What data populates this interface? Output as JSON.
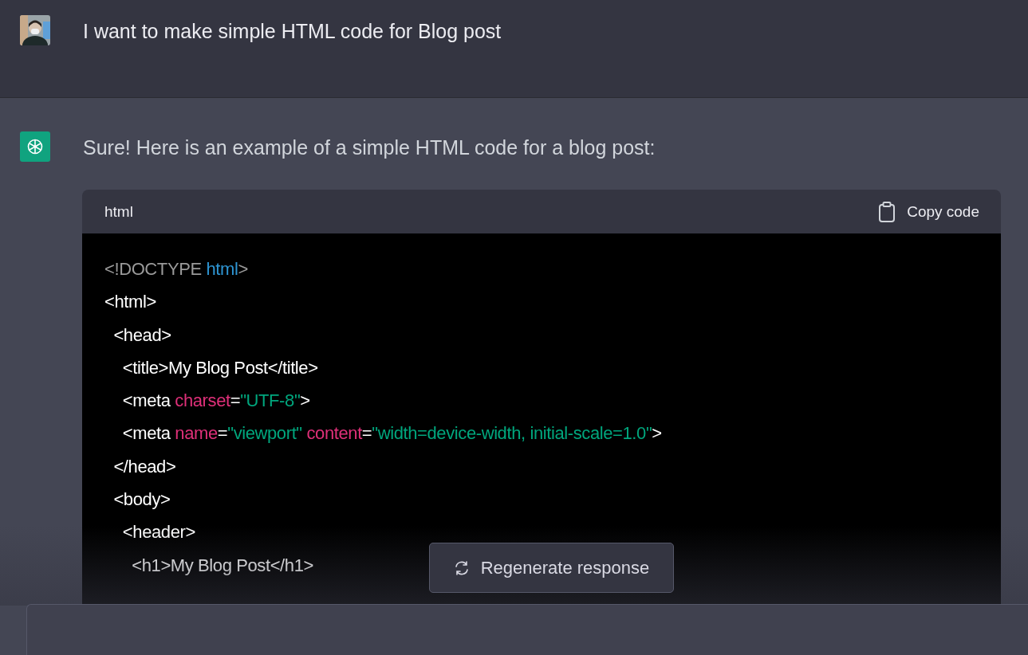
{
  "conversation": [
    {
      "kind": "user",
      "text": "I want to make simple HTML code for Blog post"
    },
    {
      "kind": "assistant",
      "text": "Sure! Here is an example of a simple HTML code for a blog post:"
    }
  ],
  "code_block": {
    "language": "html",
    "copy_button": "Copy code",
    "lines": [
      [
        {
          "kind": "doctype",
          "text": "<!DOCTYPE "
        },
        {
          "kind": "keyword",
          "text": "html"
        },
        {
          "kind": "doctype",
          "text": ">"
        }
      ],
      [
        {
          "kind": "tag",
          "text": "<html>"
        }
      ],
      [
        {
          "kind": "tag",
          "text": "  <head>"
        }
      ],
      [
        {
          "kind": "tag",
          "text": "    <title>My Blog Post</title>"
        }
      ],
      [
        {
          "kind": "tag",
          "text": "    <meta "
        },
        {
          "kind": "attr",
          "text": "charset"
        },
        {
          "kind": "tag",
          "text": "="
        },
        {
          "kind": "string",
          "text": "\"UTF-8\""
        },
        {
          "kind": "tag",
          "text": ">"
        }
      ],
      [
        {
          "kind": "tag",
          "text": "    <meta "
        },
        {
          "kind": "attr",
          "text": "name"
        },
        {
          "kind": "tag",
          "text": "="
        },
        {
          "kind": "string",
          "text": "\"viewport\""
        },
        {
          "kind": "attr",
          "text": " content"
        },
        {
          "kind": "tag",
          "text": "="
        },
        {
          "kind": "string",
          "text": "\"width=device-width, initial-scale=1.0\""
        },
        {
          "kind": "tag",
          "text": ">"
        }
      ],
      [
        {
          "kind": "tag",
          "text": "  </head>"
        }
      ],
      [
        {
          "kind": "tag",
          "text": "  <body>"
        }
      ],
      [
        {
          "kind": "tag",
          "text": "    <header>"
        }
      ],
      [
        {
          "kind": "tag",
          "text": "      <h1>My Blog Post</h1>"
        }
      ]
    ]
  },
  "regenerate_button": "Regenerate response"
}
